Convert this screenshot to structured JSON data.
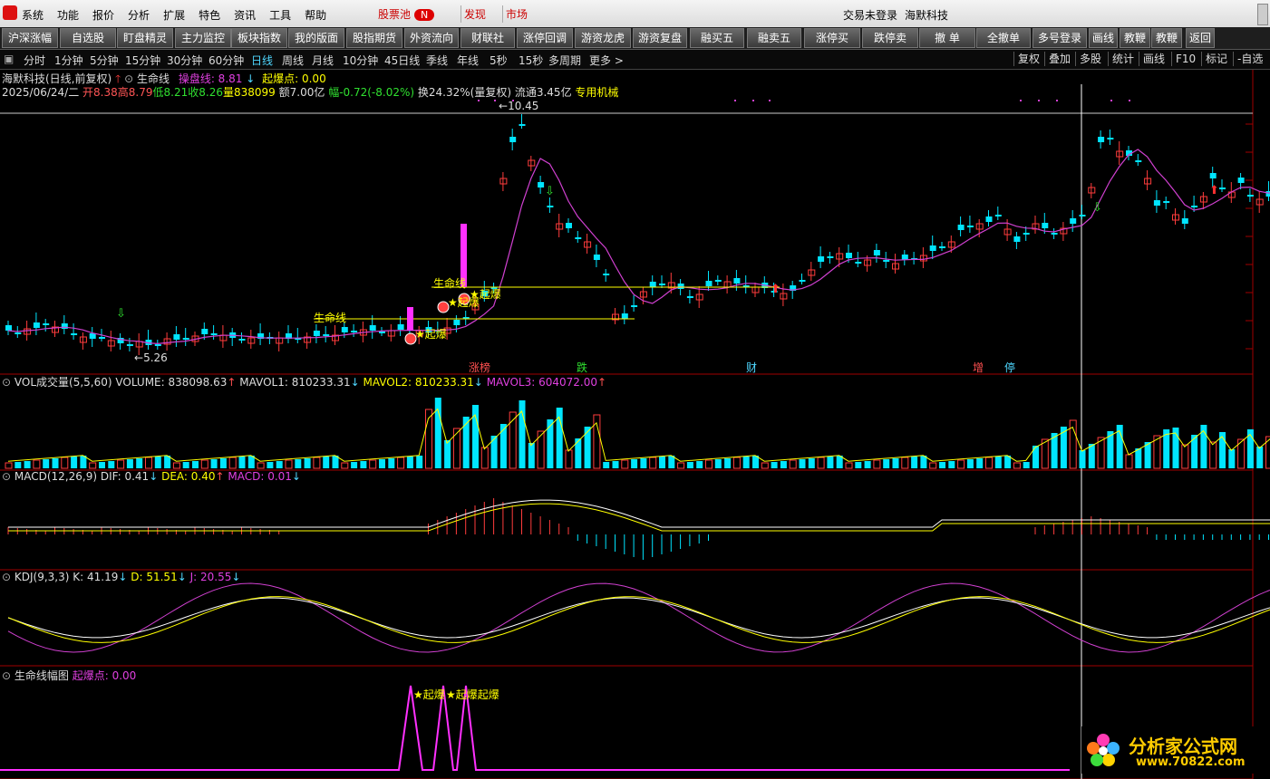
{
  "menubar": {
    "items": [
      "系统",
      "功能",
      "报价",
      "分析",
      "扩展",
      "特色",
      "资讯",
      "工具",
      "帮助"
    ],
    "stock_pool": "股票池",
    "stock_pool_badge": "N",
    "tab_discover": "发现",
    "tab_market": "市场",
    "login_status": "交易未登录",
    "stock_name": "海默科技"
  },
  "toolbar": {
    "buttons": [
      "沪深涨幅",
      "自选股",
      "盯盘精灵",
      "主力监控",
      "板块指数",
      "我的版面",
      "股指期货",
      "外资流向",
      "财联社",
      "涨停回调",
      "游资龙虎",
      "游资复盘",
      "融买五",
      "融卖五",
      "涨停买",
      "跌停卖",
      "撤 单",
      "全撤单",
      "多号登录",
      "画线",
      "教鞭A",
      "教鞭B",
      "返回"
    ]
  },
  "periodbar": {
    "periods": [
      "分时",
      "1分钟",
      "5分钟",
      "15分钟",
      "30分钟",
      "60分钟",
      "日线",
      "周线",
      "月线",
      "10分钟",
      "45日线",
      "季线",
      "年线",
      "5秒",
      "15秒",
      "多周期",
      "更多 >"
    ],
    "active": "日线",
    "right_buttons": [
      "复权",
      "叠加",
      "多股",
      "统计",
      "画线",
      "F10",
      "标记",
      "-自选"
    ]
  },
  "main": {
    "title": "海默科技(日线,前复权)",
    "indicator": "生命线",
    "cp_label": "操盘线: 8.81",
    "qb_label": "起爆点: 0.00",
    "date": "2025/06/24/二",
    "open": "开8.38",
    "high": "高8.79",
    "low": "低8.21",
    "close": "收8.26",
    "volume": "量838099",
    "amount": "额7.00亿",
    "change": "幅-0.72(-8.02%)",
    "turnover": "换24.32%(量复权)",
    "float": "流通3.45亿",
    "industry": "专用机械",
    "high_mark": "10.45",
    "low_mark": "5.26",
    "lifeline_label": "生命线",
    "burst_label": "★起爆",
    "events": [
      "涨榜",
      "跌",
      "财",
      "增",
      "停"
    ]
  },
  "vol": {
    "title": "VOL成交量(5,5,60)",
    "volume": "VOLUME: 838098.63",
    "mavol1": "MAVOL1: 810233.31",
    "mavol2": "MAVOL2: 810233.31",
    "mavol3": "MAVOL3: 604072.00"
  },
  "macd": {
    "title": "MACD(12,26,9)",
    "dif": "DIF: 0.41",
    "dea": "DEA: 0.40",
    "macd": "MACD: 0.01"
  },
  "kdj": {
    "title": "KDJ(9,3,3)",
    "k": "K: 41.19",
    "d": "D: 51.51",
    "j": "J: 20.55"
  },
  "lifeline_pane": {
    "title": "生命线幅图",
    "qb_label": "起爆点: 0.00",
    "burst1": "★起爆",
    "burst2": "★起爆起爆"
  },
  "watermark": {
    "name": "分析家公式网",
    "url": "www.70822.com"
  },
  "colors": {
    "up": "#ff3c3c",
    "down": "#00e5ff",
    "ma": "#d040d0",
    "yellow": "#ffff00",
    "axis": "#a00000"
  }
}
